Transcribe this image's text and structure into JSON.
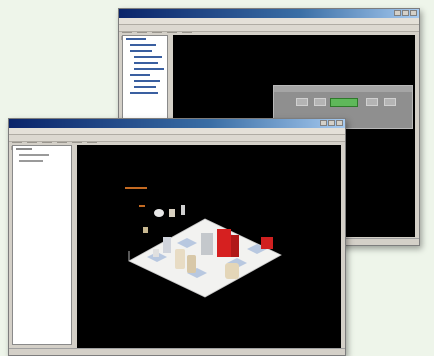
{
  "back_window": {
    "title": "",
    "dialog_progress": 0.5
  },
  "front_window": {
    "title": ""
  },
  "colors": {
    "titlebar_start": "#0a246a",
    "titlebar_end": "#a6caf0",
    "viewport": "#000000",
    "window_chrome": "#d4d0c8",
    "progress_green": "#5fb85a",
    "accent_red": "#d62020",
    "scene_floor": "#f2f2f0"
  },
  "icons": [
    "minimize-icon",
    "maximize-icon",
    "close-icon"
  ]
}
